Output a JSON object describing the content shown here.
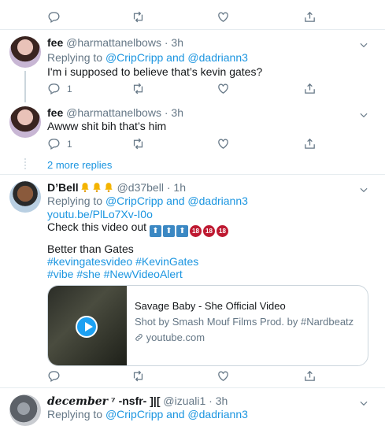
{
  "top_actions": {
    "reply_count": ""
  },
  "tweets": [
    {
      "name": "fee",
      "handle": "@harmattanelbows",
      "sep": "·",
      "time": "3h",
      "replying_prefix": "Replying to",
      "replying_to_1": "@CripCripp",
      "replying_and": "and",
      "replying_to_2": "@dadriann3",
      "text": "I'm i supposed to believe that’s kevin gates?",
      "reply_count": "1"
    },
    {
      "name": "fee",
      "handle": "@harmattanelbows",
      "sep": "·",
      "time": "3h",
      "text": "Awww shit bih that’s him",
      "reply_count": "1"
    },
    {
      "name": "D’Bell",
      "handle": "@d37bell",
      "sep": "·",
      "time": "1h",
      "replying_prefix": "Replying to",
      "replying_to_1": "@CripCripp",
      "replying_and": "and",
      "replying_to_2": "@dadriann3",
      "link": "youtu.be/PlLo7Xv-I0o",
      "text_1": "Check this video out",
      "text_2": "Better than Gates",
      "hashtags_1": "#kevingatesvideo #KevinGates",
      "hashtags_2": "#vibe #she #NewVideoAlert",
      "card": {
        "title": "Savage Baby - She Official Video",
        "description": "Shot by Smash Mouf Films Prod. by #Nardbeatz",
        "domain": "youtube.com"
      }
    },
    {
      "name": "december",
      "name_suffix": "⁷ -nsfr- ]|[",
      "handle": "@izuali1",
      "sep": "·",
      "time": "3h",
      "replying_prefix": "Replying to",
      "replying_to_1": "@CripCripp",
      "replying_and": "and",
      "replying_to_2": "@dadriann3"
    }
  ],
  "more_replies": "2 more replies",
  "colors": {
    "link": "#1b95e0",
    "muted": "#657786",
    "border": "#e6ecf0"
  }
}
